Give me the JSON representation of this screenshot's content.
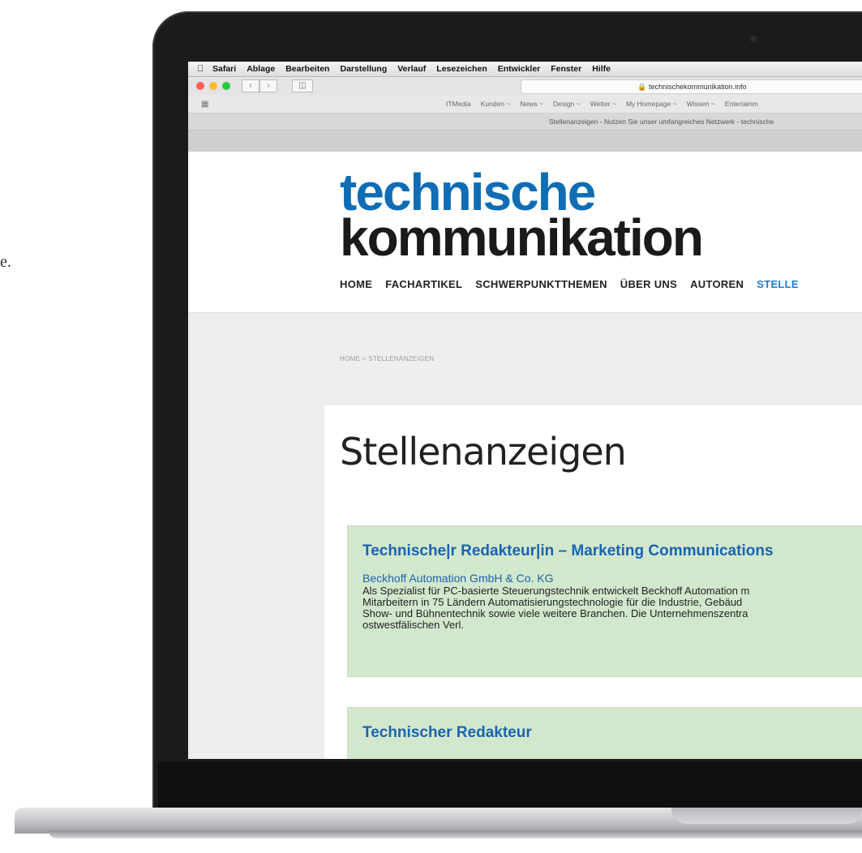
{
  "stray_text": "e.",
  "browser": {
    "menubar": [
      "Safari",
      "Ablage",
      "Bearbeiten",
      "Darstellung",
      "Verlauf",
      "Lesezeichen",
      "Entwickler",
      "Fenster",
      "Hilfe"
    ],
    "url": "technischekommunikation.info",
    "favorites": [
      "ITMedia",
      "Kunden ~",
      "News ~",
      "Design ~",
      "Wetter ~",
      "My Homepage ~",
      "Wissen ~",
      "Entertainm"
    ],
    "tab_title": "Stellenanzeigen - Nutzen Sie unser umfangreiches Netzwerk - technische"
  },
  "site": {
    "logo_line1": "technische",
    "logo_line2": "kommunikation",
    "nav": [
      "HOME",
      "FACHARTIKEL",
      "SCHWERPUNKTTHEMEN",
      "ÜBER UNS",
      "AUTOREN",
      "STELLE"
    ],
    "breadcrumb": "HOME > STELLENANZEIGEN",
    "page_title": "Stellenanzeigen",
    "jobs": [
      {
        "title": "Technische|r Redakteur|in – Marketing Communications",
        "company": "Beckhoff Automation GmbH & Co. KG",
        "description": "Als Spezialist für PC-basierte Steuerungstechnik entwickelt Beckhoff Automation m\nMitarbeitern in 75 Ländern Automatisierungstechnologie für die Industrie, Gebäud\nShow- und Bühnentechnik sowie viele weitere Branchen. Die Unternehmenszentra\nostwestfälischen Verl."
      },
      {
        "title": "Technischer Redakteur",
        "company": ""
      }
    ]
  }
}
